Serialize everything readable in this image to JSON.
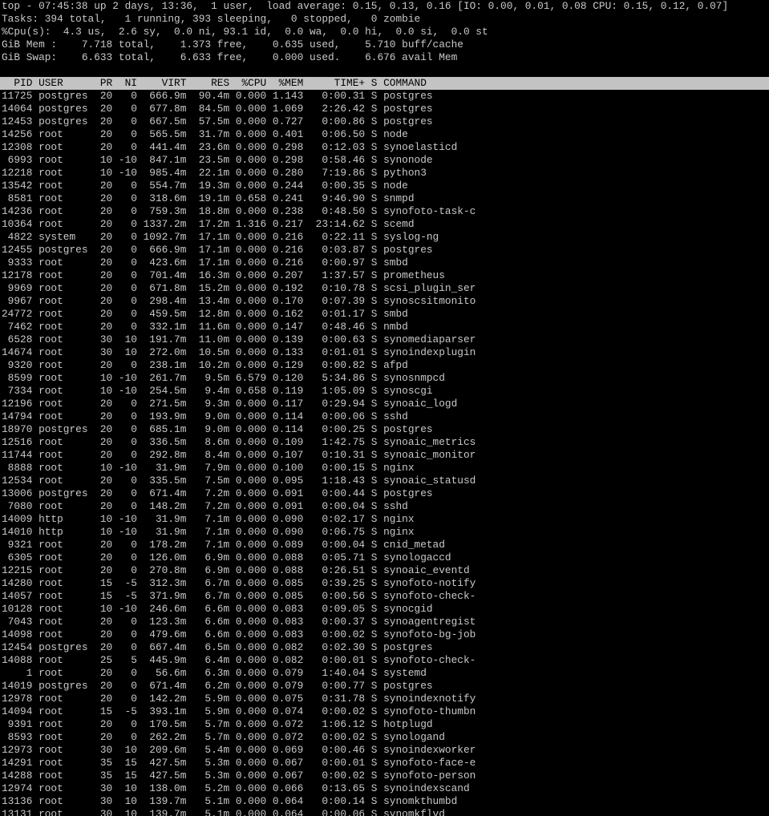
{
  "summary": [
    "top - 07:45:38 up 2 days, 13:36,  1 user,  load average: 0.15, 0.13, 0.16 [IO: 0.00, 0.01, 0.08 CPU: 0.15, 0.12, 0.07]",
    "Tasks: 394 total,   1 running, 393 sleeping,   0 stopped,   0 zombie",
    "%Cpu(s):  4.3 us,  2.6 sy,  0.0 ni, 93.1 id,  0.0 wa,  0.0 hi,  0.0 si,  0.0 st",
    "GiB Mem :    7.718 total,    1.373 free,    0.635 used,    5.710 buff/cache",
    "GiB Swap:    6.633 total,    6.633 free,    0.000 used.    6.676 avail Mem"
  ],
  "header": "  PID USER      PR  NI    VIRT    RES  %CPU  %MEM     TIME+ S COMMAND",
  "processes": [
    "11725 postgres  20   0  666.9m  90.4m 0.000 1.143   0:00.31 S postgres",
    "14064 postgres  20   0  677.8m  84.5m 0.000 1.069   2:26.42 S postgres",
    "12453 postgres  20   0  667.5m  57.5m 0.000 0.727   0:00.86 S postgres",
    "14256 root      20   0  565.5m  31.7m 0.000 0.401   0:06.50 S node",
    "12308 root      20   0  441.4m  23.6m 0.000 0.298   0:12.03 S synoelasticd",
    " 6993 root      10 -10  847.1m  23.5m 0.000 0.298   0:58.46 S synonode",
    "12218 root      10 -10  985.4m  22.1m 0.000 0.280   7:19.86 S python3",
    "13542 root      20   0  554.7m  19.3m 0.000 0.244   0:00.35 S node",
    " 8581 root      20   0  318.6m  19.1m 0.658 0.241   9:46.90 S snmpd",
    "14236 root      20   0  759.3m  18.8m 0.000 0.238   0:48.50 S synofoto-task-c",
    "10364 root      20   0 1337.2m  17.2m 1.316 0.217  23:14.62 S scemd",
    " 4822 system    20   0 1092.7m  17.1m 0.000 0.216   0:22.11 S syslog-ng",
    "12455 postgres  20   0  666.9m  17.1m 0.000 0.216   0:03.87 S postgres",
    " 9333 root      20   0  423.6m  17.1m 0.000 0.216   0:00.97 S smbd",
    "12178 root      20   0  701.4m  16.3m 0.000 0.207   1:37.57 S prometheus",
    " 9969 root      20   0  671.8m  15.2m 0.000 0.192   0:10.78 S scsi_plugin_ser",
    " 9967 root      20   0  298.4m  13.4m 0.000 0.170   0:07.39 S synoscsitmonito",
    "24772 root      20   0  459.5m  12.8m 0.000 0.162   0:01.17 S smbd",
    " 7462 root      20   0  332.1m  11.6m 0.000 0.147   0:48.46 S nmbd",
    " 6528 root      30  10  191.7m  11.0m 0.000 0.139   0:00.63 S synomediaparser",
    "14674 root      30  10  272.0m  10.5m 0.000 0.133   0:01.01 S synoindexplugin",
    " 9320 root      20   0  238.1m  10.2m 0.000 0.129   0:00.82 S afpd",
    " 8599 root      10 -10  261.7m   9.5m 6.579 0.120   5:34.86 S synosnmpcd",
    " 7334 root      10 -10  254.5m   9.4m 0.658 0.119   1:05.09 S synoscgi",
    "12196 root      20   0  271.5m   9.3m 0.000 0.117   0:29.94 S synoaic_logd",
    "14794 root      20   0  193.9m   9.0m 0.000 0.114   0:00.06 S sshd",
    "18970 postgres  20   0  685.1m   9.0m 0.000 0.114   0:00.25 S postgres",
    "12516 root      20   0  336.5m   8.6m 0.000 0.109   1:42.75 S synoaic_metrics",
    "11744 root      20   0  292.8m   8.4m 0.000 0.107   0:10.31 S synoaic_monitor",
    " 8888 root      10 -10   31.9m   7.9m 0.000 0.100   0:00.15 S nginx",
    "12534 root      20   0  335.5m   7.5m 0.000 0.095   1:18.43 S synoaic_statusd",
    "13006 postgres  20   0  671.4m   7.2m 0.000 0.091   0:00.44 S postgres",
    " 7080 root      20   0  148.2m   7.2m 0.000 0.091   0:00.04 S sshd",
    "14009 http      10 -10   31.9m   7.1m 0.000 0.090   0:02.17 S nginx",
    "14010 http      10 -10   31.9m   7.1m 0.000 0.090   0:06.75 S nginx",
    " 9321 root      20   0  178.2m   7.1m 0.000 0.089   0:00.04 S cnid_metad",
    " 6305 root      20   0  126.0m   6.9m 0.000 0.088   0:05.71 S synologaccd",
    "12215 root      20   0  270.8m   6.9m 0.000 0.088   0:26.51 S synoaic_eventd",
    "14280 root      15  -5  312.3m   6.7m 0.000 0.085   0:39.25 S synofoto-notify",
    "14057 root      15  -5  371.9m   6.7m 0.000 0.085   0:00.56 S synofoto-check-",
    "10128 root      10 -10  246.6m   6.6m 0.000 0.083   0:09.05 S synocgid",
    " 7043 root      20   0  123.3m   6.6m 0.000 0.083   0:00.37 S synoagentregist",
    "14098 root      20   0  479.6m   6.6m 0.000 0.083   0:00.02 S synofoto-bg-job",
    "12454 postgres  20   0  667.4m   6.5m 0.000 0.082   0:02.30 S postgres",
    "14088 root      25   5  445.9m   6.4m 0.000 0.082   0:00.01 S synofoto-check-",
    "    1 root      20   0   56.6m   6.3m 0.000 0.079   1:40.04 S systemd",
    "14019 postgres  20   0  671.4m   6.2m 0.000 0.079   0:00.77 S postgres",
    "12978 root      20   0  142.2m   5.9m 0.000 0.075   0:31.78 S synoindexnotify",
    "14094 root      15  -5  393.1m   5.9m 0.000 0.074   0:00.02 S synofoto-thumbn",
    " 9391 root      20   0  170.5m   5.7m 0.000 0.072   1:06.12 S hotplugd",
    " 8593 root      20   0  262.2m   5.7m 0.000 0.072   0:00.02 S synologand",
    "12973 root      30  10  209.6m   5.4m 0.000 0.069   0:00.46 S synoindexworker",
    "14291 root      35  15  427.5m   5.3m 0.000 0.067   0:00.01 S synofoto-face-e",
    "14288 root      35  15  427.5m   5.3m 0.000 0.067   0:00.02 S synofoto-person",
    "12974 root      30  10  138.0m   5.2m 0.000 0.066   0:13.65 S synoindexscand",
    "13136 root      30  10  139.7m   5.1m 0.000 0.064   0:00.14 S synomkthumbd",
    "13131 root      30  10  139.7m   5.1m 0.000 0.064   0:00.06 S synomkflvd"
  ]
}
